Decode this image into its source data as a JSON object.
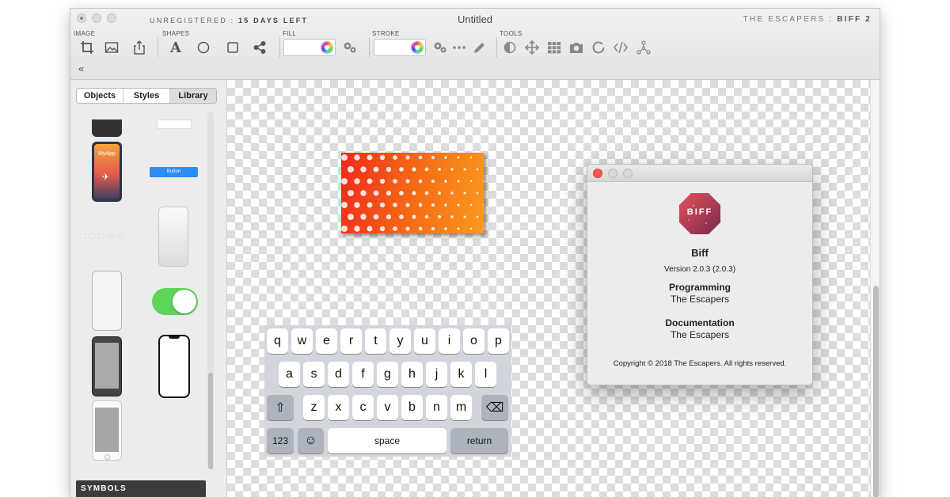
{
  "window": {
    "title": "Untitled",
    "unregistered_prefix": "UNREGISTERED",
    "unregistered_days": "15 DAYS LEFT",
    "separator": ":",
    "brand_prefix": "THE ESCAPERS",
    "brand_name": "BIFF 2"
  },
  "toolbar": {
    "groups": {
      "image": "IMAGE",
      "shapes": "SHAPES",
      "fill": "FILL",
      "stroke": "STROKE",
      "tools": "TOOLS"
    },
    "text_tool_glyph": "A",
    "collapse_glyph": "«"
  },
  "sidebar": {
    "tabs": [
      "Objects",
      "Styles",
      "Library"
    ],
    "selected_tab": "Library",
    "symbols_label": "SYMBOLS",
    "app_label": "MyApp",
    "button_label": "Button",
    "rating": {
      "value": 3,
      "max": 5
    },
    "toggle_on": true
  },
  "keyboard": {
    "row1": [
      "q",
      "w",
      "e",
      "r",
      "t",
      "y",
      "u",
      "i",
      "o",
      "p"
    ],
    "row2": [
      "a",
      "s",
      "d",
      "f",
      "g",
      "h",
      "j",
      "k",
      "l"
    ],
    "row3": [
      "z",
      "x",
      "c",
      "v",
      "b",
      "n",
      "m"
    ],
    "numbers": "123",
    "space": "space",
    "return": "return",
    "shift_glyph": "⇧",
    "delete_glyph": "⌫",
    "emoji_glyph": "☺"
  },
  "about": {
    "logo_text": "BIFF",
    "app_name": "Biff",
    "version": "Version 2.0.3 (2.0.3)",
    "programming_label": "Programming",
    "programming_value": "The Escapers",
    "documentation_label": "Documentation",
    "documentation_value": "The Escapers",
    "copyright": "Copyright © 2018 The Escapers. All rights reserved."
  },
  "colors": {
    "accent_blue": "#2b8ef2",
    "toggle_green": "#5fd45a",
    "gradient_start": "#ee2a1e",
    "gradient_end": "#fa9a1e",
    "close_red": "#fc5753"
  }
}
